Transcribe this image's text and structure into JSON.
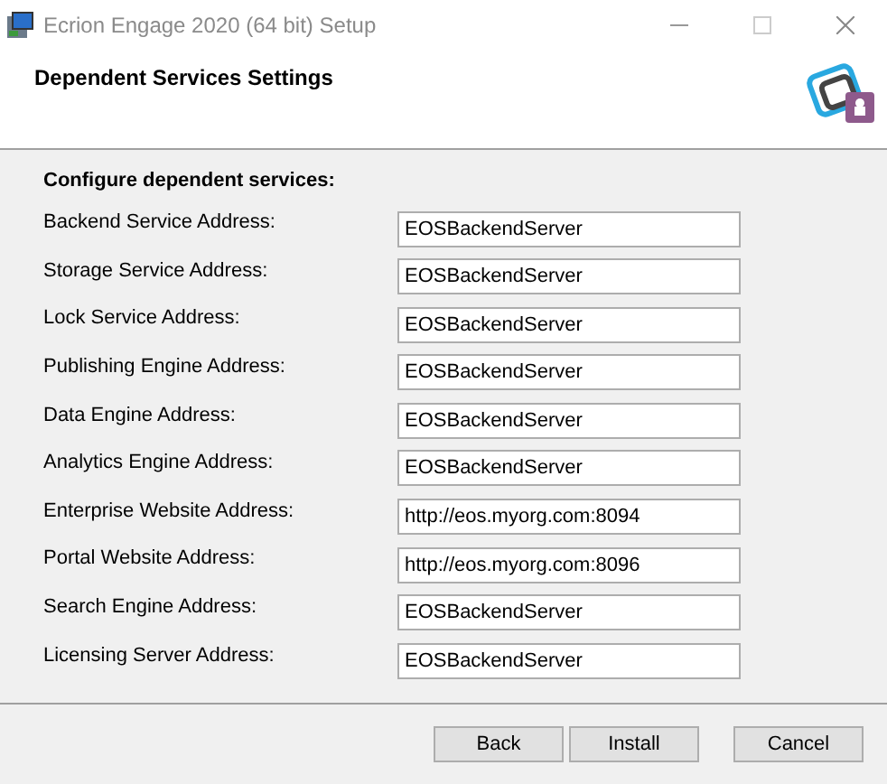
{
  "window": {
    "title": "Ecrion Engage 2020 (64 bit) Setup"
  },
  "header": {
    "title": "Dependent Services Settings"
  },
  "section_title": "Configure dependent services:",
  "fields": [
    {
      "label": "Backend Service Address:",
      "value": "EOSBackendServer"
    },
    {
      "label": "Storage Service Address:",
      "value": "EOSBackendServer"
    },
    {
      "label": "Lock Service Address:",
      "value": "EOSBackendServer"
    },
    {
      "label": "Publishing Engine Address:",
      "value": "EOSBackendServer"
    },
    {
      "label": "Data Engine Address:",
      "value": "EOSBackendServer"
    },
    {
      "label": "Analytics Engine Address:",
      "value": "EOSBackendServer"
    },
    {
      "label": "Enterprise Website Address:",
      "value": "http://eos.myorg.com:8094"
    },
    {
      "label": "Portal Website Address:",
      "value": "http://eos.myorg.com:8096"
    },
    {
      "label": "Search Engine Address:",
      "value": "EOSBackendServer"
    },
    {
      "label": "Licensing Server Address:",
      "value": "EOSBackendServer"
    }
  ],
  "buttons": [
    "Back",
    "Install",
    "Cancel"
  ]
}
